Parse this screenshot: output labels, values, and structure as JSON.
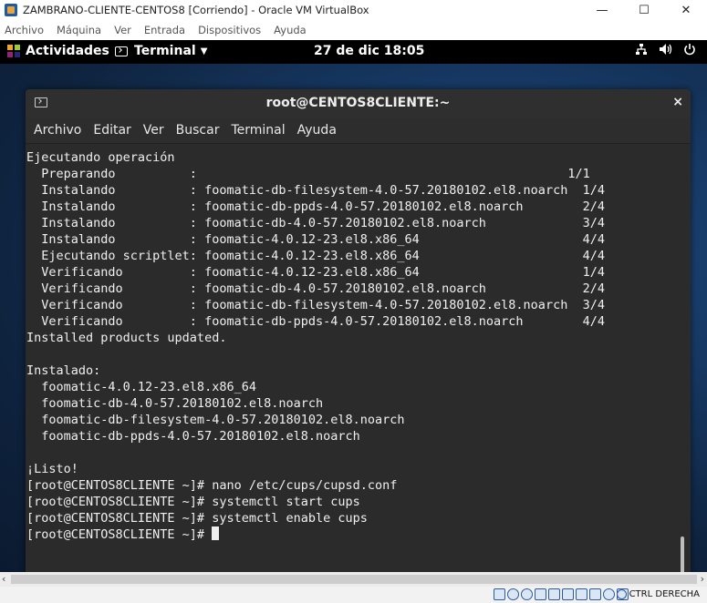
{
  "host": {
    "title": "ZAMBRANO-CLIENTE-CENTOS8 [Corriendo] - Oracle VM VirtualBox",
    "window_controls": {
      "minimize": "—",
      "maximize": "☐",
      "close": "✕"
    },
    "menu": [
      "Archivo",
      "Máquina",
      "Ver",
      "Entrada",
      "Dispositivos",
      "Ayuda"
    ],
    "statusbar": {
      "host_key": "CTRL DERECHA"
    }
  },
  "gnome": {
    "activities": "Actividades",
    "app_menu": "Terminal",
    "clock": "27 de dic  18:05",
    "tray_icons": [
      "network-icon",
      "volume-icon",
      "power-icon"
    ]
  },
  "terminal": {
    "title": "root@CENTOS8CLIENTE:~",
    "close": "×",
    "menu": [
      "Archivo",
      "Editar",
      "Ver",
      "Buscar",
      "Terminal",
      "Ayuda"
    ],
    "lines": [
      "Ejecutando operación",
      "  Preparando          :                                                  1/1",
      "  Instalando          : foomatic-db-filesystem-4.0-57.20180102.el8.noarch  1/4",
      "  Instalando          : foomatic-db-ppds-4.0-57.20180102.el8.noarch        2/4",
      "  Instalando          : foomatic-db-4.0-57.20180102.el8.noarch             3/4",
      "  Instalando          : foomatic-4.0.12-23.el8.x86_64                      4/4",
      "  Ejecutando scriptlet: foomatic-4.0.12-23.el8.x86_64                      4/4",
      "  Verificando         : foomatic-4.0.12-23.el8.x86_64                      1/4",
      "  Verificando         : foomatic-db-4.0-57.20180102.el8.noarch             2/4",
      "  Verificando         : foomatic-db-filesystem-4.0-57.20180102.el8.noarch  3/4",
      "  Verificando         : foomatic-db-ppds-4.0-57.20180102.el8.noarch        4/4",
      "Installed products updated.",
      "",
      "Instalado:",
      "  foomatic-4.0.12-23.el8.x86_64",
      "  foomatic-db-4.0-57.20180102.el8.noarch",
      "  foomatic-db-filesystem-4.0-57.20180102.el8.noarch",
      "  foomatic-db-ppds-4.0-57.20180102.el8.noarch",
      "",
      "¡Listo!",
      "[root@CENTOS8CLIENTE ~]# nano /etc/cups/cupsd.conf",
      "[root@CENTOS8CLIENTE ~]# systemctl start cups",
      "[root@CENTOS8CLIENTE ~]# systemctl enable cups",
      "[root@CENTOS8CLIENTE ~]# "
    ],
    "annotation_color": "#8fd3f4"
  }
}
